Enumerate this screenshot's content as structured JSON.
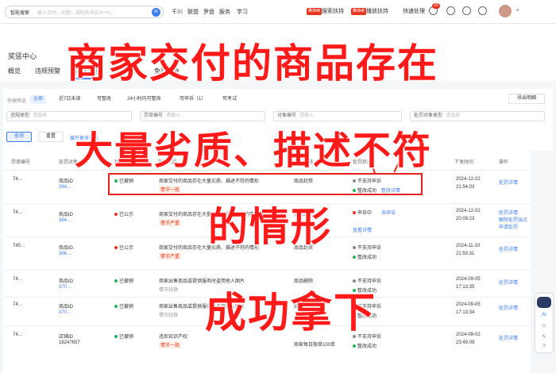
{
  "topbar": {
    "search_tag": "智能搜索",
    "search_placeholder": "输入合同、问题、规则名称(Ctrl+K)",
    "search_ai": "AI",
    "nav": [
      "千川",
      "联盟",
      "罗盘",
      "服务",
      "学习"
    ],
    "promo_tag_1": "推持续",
    "promo_link_1": "搜索扶持",
    "promo_tag_2": "推持续",
    "promo_link_2": "播放扶持",
    "quick_process": "快速处理",
    "notif_count": "29"
  },
  "page": {
    "title": "奖惩中心",
    "tabs": [
      "概览",
      "违规预警",
      "违规管理",
      "违规申诉",
      "免罚机会"
    ]
  },
  "filters": {
    "quick_label": "快捷筛选",
    "quick_chips": [
      "全部",
      "近7日未读",
      "可整改",
      "24小时内可整改",
      "可申诉（1）",
      "可考试"
    ],
    "export_label": "导出明细",
    "fields": [
      {
        "label": "违规类型",
        "placeholder": "请选择"
      },
      {
        "label": "罚单编号",
        "placeholder": "请输入"
      },
      {
        "label": "对象编号",
        "placeholder": "请输入"
      },
      {
        "label": "处罚对象类型",
        "placeholder": "请选择"
      }
    ],
    "query_label": "查询",
    "reset_label": "重置",
    "expand_label": "展开更多筛选"
  },
  "table": {
    "headers": [
      "罚单编号",
      "处罚对象",
      "状态",
      "违规原因",
      "处罚措施",
      "处罚状态",
      "下发时间",
      "操作"
    ],
    "rows": [
      {
        "id": "74…",
        "obj_type": "商品ID",
        "obj_id": "364…",
        "status": "已撤销",
        "status_color": "green",
        "reason": "商家交付的商品存在大量劣质、描述不符的情形",
        "reason_tag": "情节一般",
        "measure": "商品封禁",
        "states": [
          "不支持申诉",
          "整改成功"
        ],
        "state_link": "整改详情",
        "time": "2024-12-02",
        "clock": "21:54:03",
        "ops": [
          "处罚详情"
        ]
      },
      {
        "id": "74…",
        "obj_type": "商品ID",
        "obj_id": "364…",
        "status": "已公示",
        "status_color": "red",
        "reason": "商家交付的商品存在大量劣质、描述不符的情形",
        "reason_tag": "情节严重",
        "measure": "商品封禁",
        "states": [
          "申诉中",
          "去申诉"
        ],
        "state_link": "查看详情",
        "time": "2024-12-02",
        "clock": "20:09:23",
        "ops": [
          "处罚详情",
          "解除处罚误点",
          "申请处罚"
        ]
      },
      {
        "id": "745…",
        "obj_type": "商品ID",
        "obj_id": "366…",
        "status": "已公示",
        "status_color": "red",
        "reason": "商家交付的商品存在大量劣质、描述不符的情形",
        "reason_tag": "情节严重",
        "measure": "商品封禁",
        "states": [
          "不支持申诉",
          "整改成功"
        ],
        "state_link": "",
        "time": "2024-11-10",
        "clock": "21:50:31",
        "ops": [
          "处罚详情"
        ]
      },
      {
        "id": "74…",
        "obj_type": "商品ID",
        "obj_id": "370…",
        "status": "已撤销",
        "status_color": "green",
        "reason": "商家出售商品或提供服务时盗用他人图片",
        "reason_tag": "情节轻微",
        "measure": "商品删除",
        "states": [
          "不支持申诉",
          "整改成功"
        ],
        "state_link": "",
        "time": "2024-09-05",
        "clock": "17:13:35",
        "ops": [
          "处罚详情"
        ]
      },
      {
        "id": "74…",
        "obj_type": "商品ID",
        "obj_id": "370…",
        "status": "已撤销",
        "status_color": "green",
        "reason": "商家出售商品或提供服务时盗用他人图片",
        "reason_tag": "情节轻微",
        "measure": "商品删除",
        "states": [
          "不支持申诉",
          "整改成功"
        ],
        "state_link": "",
        "time": "2024-09-05",
        "clock": "17:13:34",
        "ops": [
          "处罚详情"
        ]
      },
      {
        "id": "74…",
        "obj_type": "店铺ID",
        "obj_id": "18247657",
        "status": "已撤销",
        "status_color": "green",
        "reason": "违反知识产权",
        "reason_tag": "情节一般",
        "measure": "商家每日限单100单",
        "states": [
          "不支持申诉",
          "整改成功"
        ],
        "state_link": "",
        "time": "2024-09-02",
        "clock": "23:49:09",
        "ops": [
          "处罚详情"
        ]
      }
    ]
  },
  "overlay": {
    "line1": "商家交付的商品存在",
    "line2": "大量劣质、描述不符",
    "line3": "的情形",
    "line4": "成功拿下"
  },
  "colors": {
    "overlay": "#ff1a1a",
    "accent": "#3d7cf5",
    "highlight": "#e8201c"
  }
}
